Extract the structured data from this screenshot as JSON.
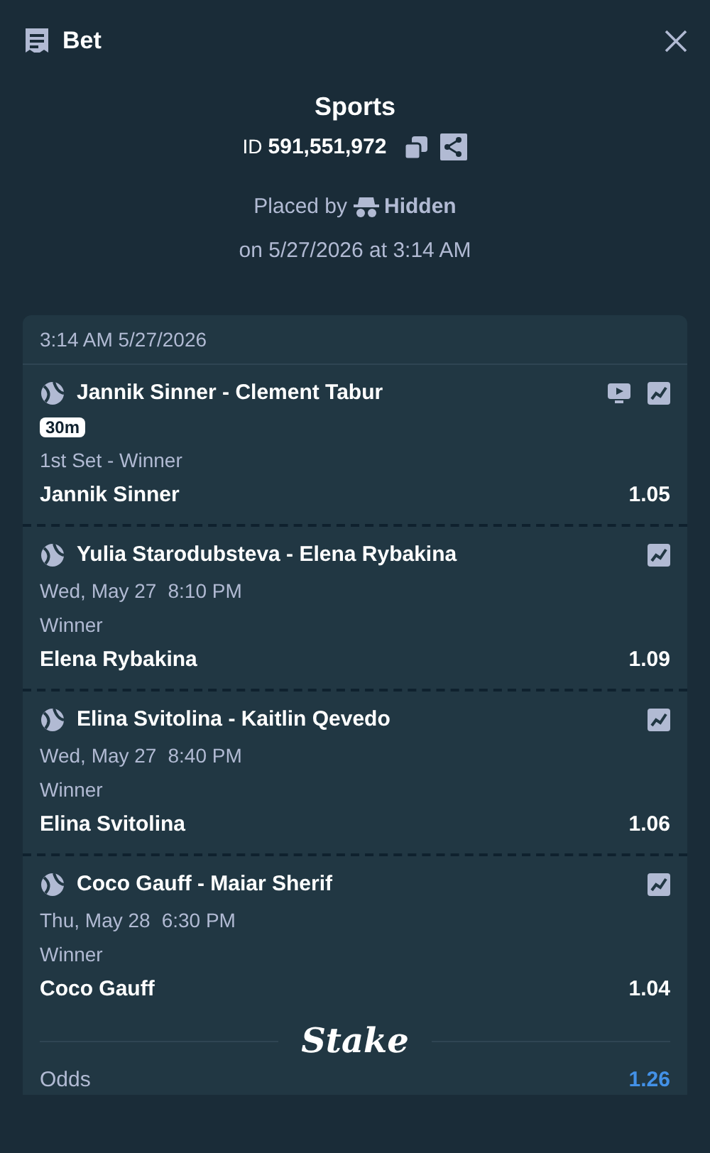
{
  "header": {
    "title": "Bet"
  },
  "summary": {
    "title": "Sports",
    "id_label": "ID",
    "id_value": "591,551,972",
    "placed_by_label": "Placed by",
    "placed_by_user": "Hidden",
    "placed_on": "on 5/27/2026 at 3:14 AM"
  },
  "slip": {
    "timestamp": "3:14 AM 5/27/2026",
    "legs": [
      {
        "match": "Jannik Sinner - Clement Tabur",
        "kind": "live",
        "badge": "30m",
        "stream": true,
        "market": "1st Set - Winner",
        "selection": "Jannik Sinner",
        "odds": "1.05"
      },
      {
        "match": "Yulia Starodubsteva - Elena Rybakina",
        "kind": "scheduled",
        "date": "Wed, May 27",
        "time": "8:10 PM",
        "stream": false,
        "market": "Winner",
        "selection": "Elena Rybakina",
        "odds": "1.09"
      },
      {
        "match": "Elina Svitolina - Kaitlin Qevedo",
        "kind": "scheduled",
        "date": "Wed, May 27",
        "time": "8:40 PM",
        "stream": false,
        "market": "Winner",
        "selection": "Elina Svitolina",
        "odds": "1.06"
      },
      {
        "match": "Coco Gauff - Maiar Sherif",
        "kind": "scheduled",
        "date": "Thu, May 28",
        "time": "6:30 PM",
        "stream": false,
        "market": "Winner",
        "selection": "Coco Gauff",
        "odds": "1.04"
      }
    ],
    "brand": "Stake",
    "odds_label": "Odds",
    "odds_value": "1.26"
  }
}
